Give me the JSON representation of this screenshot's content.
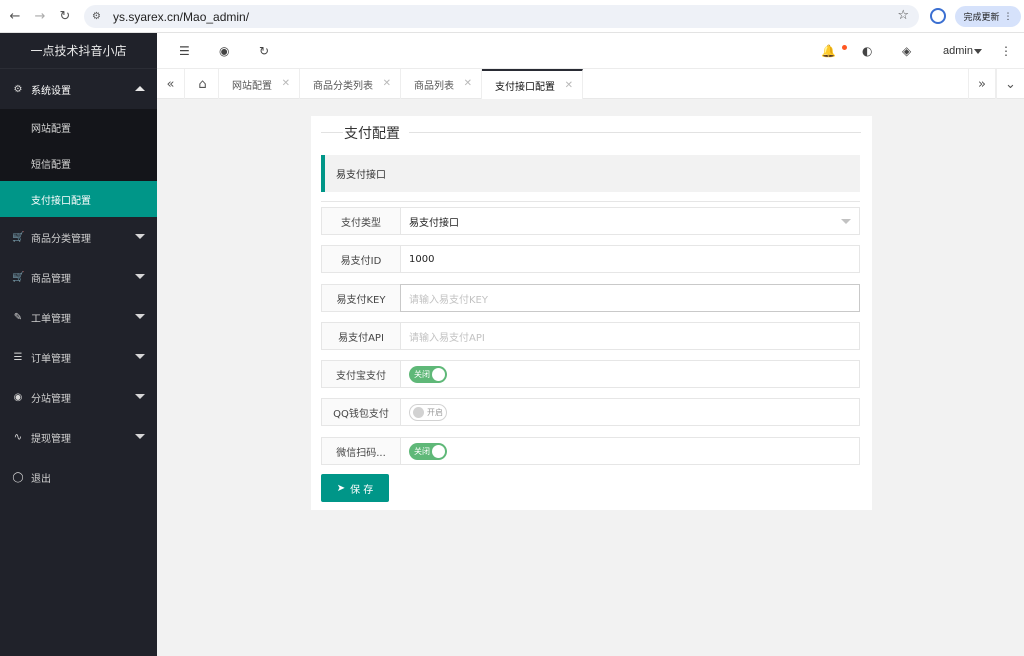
{
  "browser": {
    "url": "ys.syarex.cn/Mao_admin/",
    "update_button": "完成更新"
  },
  "sidebar": {
    "logo": "一点技术抖音小店",
    "items": [
      {
        "label": "系统设置",
        "icon": "gear-icon",
        "expanded": true,
        "children": [
          {
            "label": "网站配置"
          },
          {
            "label": "短信配置"
          },
          {
            "label": "支付接口配置",
            "active": true
          }
        ]
      },
      {
        "label": "商品分类管理",
        "icon": "cart-icon"
      },
      {
        "label": "商品管理",
        "icon": "cart-icon"
      },
      {
        "label": "工单管理",
        "icon": "edit-icon"
      },
      {
        "label": "订单管理",
        "icon": "layers-icon"
      },
      {
        "label": "分站管理",
        "icon": "globe-icon"
      },
      {
        "label": "提现管理",
        "icon": "pulse-icon"
      },
      {
        "label": "退出",
        "icon": "shield-icon"
      }
    ]
  },
  "header": {
    "user": "admin"
  },
  "tabs": [
    {
      "label": "网站配置"
    },
    {
      "label": "商品分类列表"
    },
    {
      "label": "商品列表"
    },
    {
      "label": "支付接口配置",
      "active": true
    }
  ],
  "form": {
    "title": "支付配置",
    "section": "易支付接口",
    "pay_type": {
      "label": "支付类型",
      "value": "易支付接口"
    },
    "pay_id": {
      "label": "易支付ID",
      "value": "1000"
    },
    "pay_key": {
      "label": "易支付KEY",
      "placeholder": "请输入易支付KEY"
    },
    "pay_api": {
      "label": "易支付API",
      "placeholder": "请输入易支付API"
    },
    "alipay": {
      "label": "支付宝支付",
      "state": "关闭",
      "on": true
    },
    "qqpay": {
      "label": "QQ钱包支付",
      "state": "开启",
      "on": false
    },
    "wxpay": {
      "label": "微信扫码...",
      "state": "关闭",
      "on": true
    },
    "save": "保 存"
  },
  "colors": {
    "accent": "#009688",
    "sidebar": "#20222a",
    "switch_on": "#5fb878"
  }
}
